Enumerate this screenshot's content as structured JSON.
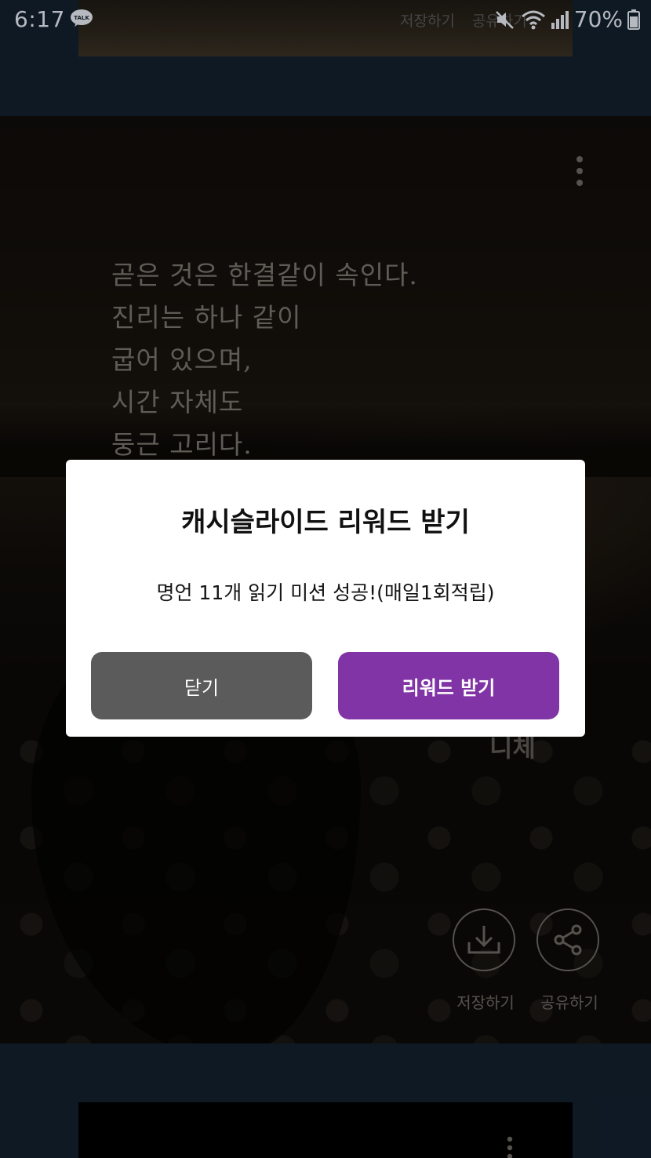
{
  "status_bar": {
    "time": "6:17",
    "notification_icon": "kakaotalk-icon",
    "talk_label": "TALK",
    "battery_percent": "70%",
    "icons": [
      "mute-icon",
      "wifi-icon",
      "signal-icon",
      "battery-icon"
    ]
  },
  "top_card": {
    "save_label": "저장하기",
    "share_label": "공유하기"
  },
  "quote_card": {
    "quote_lines": [
      "곧은 것은 한결같이 속인다.",
      "진리는 하나 같이",
      "굽어 있으며,",
      "시간 자체도",
      "둥근 고리다."
    ],
    "author": "니체",
    "save_label": "저장하기",
    "share_label": "공유하기"
  },
  "dialog": {
    "title": "캐시슬라이드 리워드 받기",
    "message": "명언 11개 읽기 미션 성공!(매일1회적립)",
    "close_label": "닫기",
    "reward_label": "리워드 받기"
  },
  "colors": {
    "reward_button": "#8034a6",
    "close_button": "#5b5b5b",
    "page_background": "#13202f"
  }
}
